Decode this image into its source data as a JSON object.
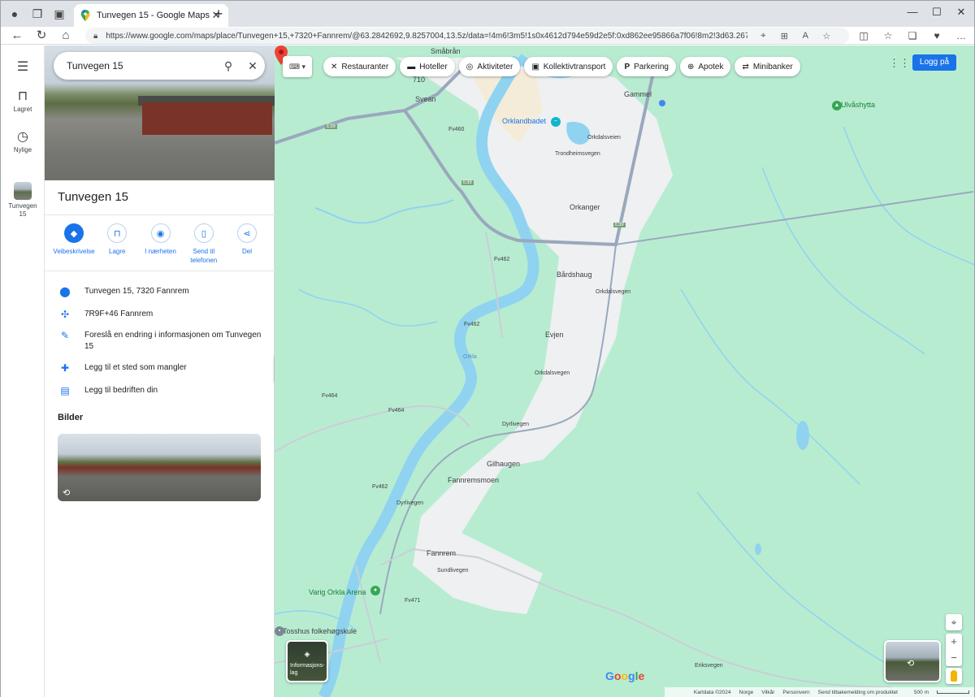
{
  "browser": {
    "tab_title": "Tunvegen 15 - Google Maps",
    "url": "https://www.google.com/maps/place/Tunvegen+15,+7320+Fannrem/@63.2842692,9.8257004,13.5z/data=!4m6!3m5!1s0x4612d794e59d2e5f:0xd862ee95866a7f06!8m2!3d63.2677784!...",
    "icons": [
      "profile-icon",
      "collections-icon",
      "tab-actions-icon",
      "close-icon",
      "new-tab-icon",
      "back-icon",
      "refresh-icon",
      "home-icon",
      "lock-icon",
      "location-icon",
      "app-icon",
      "read-aloud-icon",
      "favorite-icon",
      "split-screen-icon",
      "favorites-icon",
      "collections-icon",
      "extensions-icon",
      "more-icon"
    ]
  },
  "rail": {
    "menu_icon": "menu-icon",
    "items": [
      {
        "label": "Lagret",
        "icon": "bookmark-icon"
      },
      {
        "label": "Nylige",
        "icon": "history-icon"
      },
      {
        "label": "Tunvegen 15",
        "icon": "place-thumbnail"
      }
    ]
  },
  "panel": {
    "search_value": "Tunvegen 15",
    "place_title": "Tunvegen 15",
    "actions": [
      {
        "label": "Veibeskrivelse",
        "icon": "directions-icon"
      },
      {
        "label": "Lagre",
        "icon": "bookmark-icon"
      },
      {
        "label": "I nærheten",
        "icon": "nearby-icon"
      },
      {
        "label": "Send til telefonen",
        "icon": "send-to-phone-icon"
      },
      {
        "label": "Del",
        "icon": "share-icon"
      }
    ],
    "info": [
      {
        "text": "Tunvegen 15, 7320 Fannrem",
        "icon": "location-pin-icon"
      },
      {
        "text": "7R9F+46 Fannrem",
        "icon": "plus-code-icon"
      },
      {
        "text": "Foreslå en endring i informasjonen om Tunvegen 15",
        "icon": "edit-icon"
      },
      {
        "text": "Legg til et sted som mangler",
        "icon": "add-place-icon"
      },
      {
        "text": "Legg til bedriften din",
        "icon": "add-business-icon"
      }
    ],
    "photos_title": "Bilder"
  },
  "map": {
    "chips": [
      {
        "label": "Restauranter",
        "icon": "restaurant-icon"
      },
      {
        "label": "Hoteller",
        "icon": "hotel-icon"
      },
      {
        "label": "Aktiviteter",
        "icon": "camera-icon"
      },
      {
        "label": "Kollektivtransport",
        "icon": "transit-icon"
      },
      {
        "label": "Parkering",
        "icon": "parking-icon"
      },
      {
        "label": "Apotek",
        "icon": "pharmacy-icon"
      },
      {
        "label": "Minibanker",
        "icon": "atm-icon"
      }
    ],
    "login_label": "Logg på",
    "labels": {
      "svean": "Svean",
      "orklandbadet": "Orklandbadet",
      "ulvashytta": "Ulvåshytta",
      "orkanger": "Orkanger",
      "bardshaug": "Bårdshaug",
      "evjen": "Evjen",
      "gilhaugen": "Gilhaugen",
      "fannremsmoen": "Fannremsmoen",
      "fannrem": "Fannrem",
      "varig_orkla_arena": "Varig Orkla Arena",
      "tosshus": "Tosshus folkehøgskule",
      "sundlivegen": "Sundlivegen",
      "eriksvegen": "Eriksvegen",
      "orkla": "Orkla",
      "e39": "E39",
      "e39b": "E39",
      "e39c": "E39",
      "fv460": "Fv460",
      "fv462": "Fv462",
      "fv462b": "Fv462",
      "fv462c": "Fv462",
      "fv464": "Fv464",
      "fv464b": "Fv464",
      "fv471": "Fv471",
      "dyrlivegen": "Dyrlivegen",
      "dyrlivegen2": "Dyrlivegen",
      "smabran": "Småbrån",
      "fv710": "710",
      "gammel": "Gammel",
      "trondheimsvegen": "Trondheimsvegen",
      "orkdalsveien": "Orkdalsveien",
      "orkdalsvegen": "Orkdalsvegen",
      "orkdalsvegen2": "Orkdalsvegen"
    },
    "layers_label": "Informasjons-lag",
    "google_logo": [
      "G",
      "o",
      "o",
      "g",
      "l",
      "e"
    ],
    "footer": {
      "kartdata": "Kartdata ©2024",
      "norge": "Norge",
      "vilkar": "Vilkår",
      "personvern": "Personvern",
      "feedback": "Send tilbakemelding om produktet",
      "scale": "500 m"
    },
    "controls": [
      "my-location-icon",
      "zoom-in-icon",
      "zoom-out-icon",
      "pegman-icon"
    ],
    "colors": {
      "land": "#b8ecd1",
      "water": "#8fd3f1",
      "urban": "#f1f3f4",
      "road": "#9aa8bd",
      "accent": "#1a73e8",
      "pin": "#ea4335"
    }
  }
}
